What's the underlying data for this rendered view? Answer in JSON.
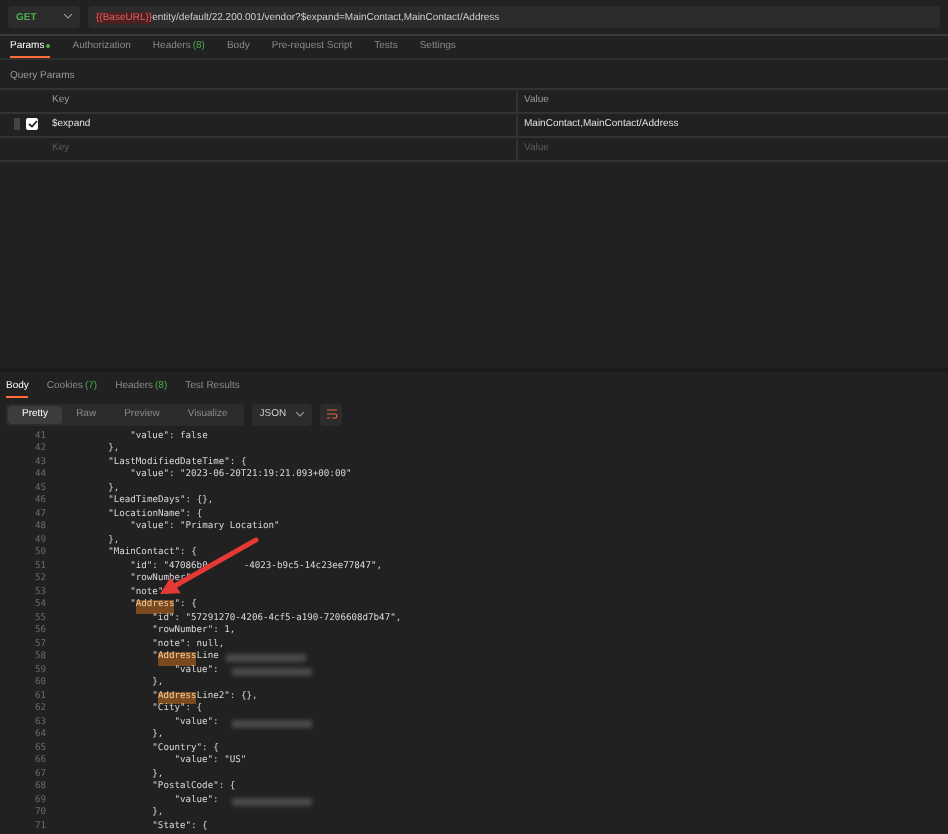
{
  "request": {
    "method": "GET",
    "url_variable": "{{BaseURL}}",
    "url_path": "entity/default/22.200.001/vendor?$expand=MainContact,MainContact/Address"
  },
  "request_tabs": [
    {
      "label": "Params",
      "selected": true,
      "dot": true
    },
    {
      "label": "Authorization",
      "selected": false
    },
    {
      "label": "Headers",
      "count": "(8)",
      "selected": false
    },
    {
      "label": "Body",
      "selected": false
    },
    {
      "label": "Pre-request Script",
      "selected": false
    },
    {
      "label": "Tests",
      "selected": false
    },
    {
      "label": "Settings",
      "selected": false
    }
  ],
  "query_params": {
    "title": "Query Params",
    "columns": [
      "Key",
      "Value"
    ],
    "rows": [
      {
        "key": "$expand",
        "value": "MainContact,MainContact/Address",
        "checked": true
      }
    ],
    "new_row": {
      "key_placeholder": "Key",
      "value_placeholder": "Value"
    }
  },
  "response_tabs": [
    {
      "label": "Body",
      "selected": true
    },
    {
      "label": "Cookies",
      "count": "(7)",
      "selected": false
    },
    {
      "label": "Headers",
      "count": "(8)",
      "selected": false
    },
    {
      "label": "Test Results",
      "selected": false
    }
  ],
  "view_modes": [
    {
      "label": "Pretty",
      "selected": true
    },
    {
      "label": "Raw",
      "selected": false
    },
    {
      "label": "Preview",
      "selected": false
    },
    {
      "label": "Visualize",
      "selected": false
    }
  ],
  "format": "JSON",
  "code_lines": [
    {
      "no": "41",
      "segs": [
        {
          "kind": "plain",
          "text": "            \"value\": false"
        }
      ]
    },
    {
      "no": "42",
      "segs": [
        {
          "kind": "plain",
          "text": "        },"
        }
      ]
    },
    {
      "no": "43",
      "segs": [
        {
          "kind": "plain",
          "text": "        \"LastModifiedDateTime\": {"
        }
      ]
    },
    {
      "no": "44",
      "segs": [
        {
          "kind": "plain",
          "text": "            \"value\": \"2023-06-20T21:19:21.093+00:00\""
        }
      ]
    },
    {
      "no": "45",
      "segs": [
        {
          "kind": "plain",
          "text": "        },"
        }
      ]
    },
    {
      "no": "46",
      "segs": [
        {
          "kind": "plain",
          "text": "        \"LeadTimeDays\": {},"
        }
      ]
    },
    {
      "no": "47",
      "segs": [
        {
          "kind": "plain",
          "text": "        \"LocationName\": {"
        }
      ]
    },
    {
      "no": "48",
      "segs": [
        {
          "kind": "plain",
          "text": "            \"value\": \"Primary Location\""
        }
      ]
    },
    {
      "no": "49",
      "segs": [
        {
          "kind": "plain",
          "text": "        },"
        }
      ]
    },
    {
      "no": "50",
      "segs": [
        {
          "kind": "plain",
          "text": "        \"MainContact\": {"
        }
      ]
    },
    {
      "no": "51",
      "segs": [
        {
          "kind": "plain",
          "text": "            \"id\": \"47086b0"
        },
        {
          "kind": "hidden"
        },
        {
          "kind": "plain",
          "text": "-4023-b9c5-14c23ee77847\","
        }
      ]
    },
    {
      "no": "52",
      "segs": [
        {
          "kind": "plain",
          "text": "            \"rowNumber\""
        }
      ]
    },
    {
      "no": "53",
      "segs": [
        {
          "kind": "plain",
          "text": "            \"note\":"
        }
      ]
    },
    {
      "no": "54",
      "segs": [
        {
          "kind": "plain",
          "text": "            \""
        },
        {
          "kind": "match",
          "text": "Address"
        },
        {
          "kind": "plain",
          "text": "\": {"
        }
      ]
    },
    {
      "no": "55",
      "segs": [
        {
          "kind": "plain",
          "text": "                \"id\": \"57291270-4206-4cf5-a190-7206608d7b47\","
        }
      ]
    },
    {
      "no": "56",
      "segs": [
        {
          "kind": "plain",
          "text": "                \"rowNumber\": 1,"
        }
      ]
    },
    {
      "no": "57",
      "segs": [
        {
          "kind": "plain",
          "text": "                \"note\": null,"
        }
      ]
    },
    {
      "no": "58",
      "segs": [
        {
          "kind": "plain",
          "text": "                \""
        },
        {
          "kind": "match",
          "text": "Address"
        },
        {
          "kind": "plain",
          "text": "Line"
        },
        {
          "kind": "redacted"
        }
      ]
    },
    {
      "no": "59",
      "segs": [
        {
          "kind": "plain",
          "text": "                    \"value\": "
        },
        {
          "kind": "redacted"
        }
      ]
    },
    {
      "no": "60",
      "segs": [
        {
          "kind": "plain",
          "text": "                },"
        }
      ]
    },
    {
      "no": "61",
      "segs": [
        {
          "kind": "plain",
          "text": "                \""
        },
        {
          "kind": "match",
          "text": "Address"
        },
        {
          "kind": "plain",
          "text": "Line2\": {},"
        }
      ]
    },
    {
      "no": "62",
      "segs": [
        {
          "kind": "plain",
          "text": "                \"City\": {"
        }
      ]
    },
    {
      "no": "63",
      "segs": [
        {
          "kind": "plain",
          "text": "                    \"value\": "
        },
        {
          "kind": "redacted"
        }
      ]
    },
    {
      "no": "64",
      "segs": [
        {
          "kind": "plain",
          "text": "                },"
        }
      ]
    },
    {
      "no": "65",
      "segs": [
        {
          "kind": "plain",
          "text": "                \"Country\": {"
        }
      ]
    },
    {
      "no": "66",
      "segs": [
        {
          "kind": "plain",
          "text": "                    \"value\": \"US\""
        }
      ]
    },
    {
      "no": "67",
      "segs": [
        {
          "kind": "plain",
          "text": "                },"
        }
      ]
    },
    {
      "no": "68",
      "segs": [
        {
          "kind": "plain",
          "text": "                \"PostalCode\": {"
        }
      ]
    },
    {
      "no": "69",
      "segs": [
        {
          "kind": "plain",
          "text": "                    \"value\": "
        },
        {
          "kind": "redacted"
        }
      ]
    },
    {
      "no": "70",
      "segs": [
        {
          "kind": "plain",
          "text": "                },"
        }
      ]
    },
    {
      "no": "71",
      "segs": [
        {
          "kind": "plain",
          "text": "                \"State\": {"
        }
      ]
    }
  ]
}
